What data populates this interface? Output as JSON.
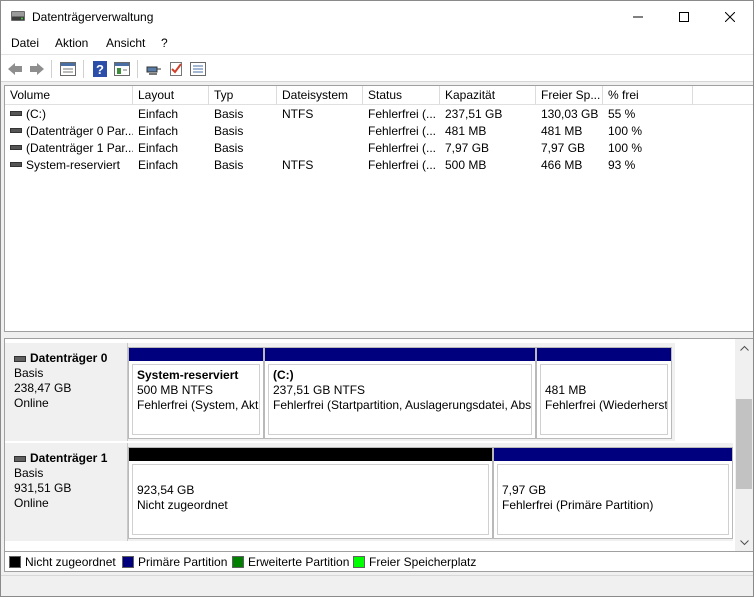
{
  "window": {
    "title": "Datenträgerverwaltung"
  },
  "menu": [
    "Datei",
    "Aktion",
    "Ansicht",
    "?"
  ],
  "toolbar": [
    "back-icon",
    "forward-icon",
    "properties-icon",
    "help-icon",
    "view-icon",
    "connect-icon",
    "check-icon",
    "list-icon"
  ],
  "volumes": {
    "columns": [
      "Volume",
      "Layout",
      "Typ",
      "Dateisystem",
      "Status",
      "Kapazität",
      "Freier Sp...",
      "% frei"
    ],
    "rows": [
      [
        "(C:)",
        "Einfach",
        "Basis",
        "NTFS",
        "Fehlerfrei (...",
        "237,51 GB",
        "130,03 GB",
        "55 %"
      ],
      [
        "(Datenträger 0 Par...",
        "Einfach",
        "Basis",
        "",
        "Fehlerfrei (...",
        "481 MB",
        "481 MB",
        "100 %"
      ],
      [
        "(Datenträger 1 Par...",
        "Einfach",
        "Basis",
        "",
        "Fehlerfrei (...",
        "7,97 GB",
        "7,97 GB",
        "100 %"
      ],
      [
        "System-reserviert",
        "Einfach",
        "Basis",
        "NTFS",
        "Fehlerfrei (...",
        "500 MB",
        "466 MB",
        "93 %"
      ]
    ]
  },
  "disks": [
    {
      "name": "Datenträger 0",
      "type": "Basis",
      "size": "238,47 GB",
      "state": "Online",
      "partitions": [
        {
          "name": "System-reserviert",
          "size": "500 MB NTFS",
          "status": "Fehlerfrei (System, Aktiv, Primäre Partition)",
          "bar_color": "#00007f"
        },
        {
          "name": "(C:)",
          "size": "237,51 GB NTFS",
          "status": "Fehlerfrei (Startpartition, Auslagerungsdatei, Absturzabbild, Primäre Partition)",
          "bar_color": "#00007f"
        },
        {
          "name": "",
          "size": "481 MB",
          "status": "Fehlerfrei (Wiederherstellungspartition)",
          "bar_color": "#00007f"
        }
      ]
    },
    {
      "name": "Datenträger 1",
      "type": "Basis",
      "size": "931,51 GB",
      "state": "Online",
      "partitions": [
        {
          "name": "",
          "size": "923,54 GB",
          "status": "Nicht zugeordnet",
          "bar_color": "#000000"
        },
        {
          "name": "",
          "size": "7,97 GB",
          "status": "Fehlerfrei (Primäre Partition)",
          "bar_color": "#00007f"
        }
      ]
    }
  ],
  "legend": [
    {
      "label": "Nicht zugeordnet",
      "color": "#000000"
    },
    {
      "label": "Primäre Partition",
      "color": "#00007f"
    },
    {
      "label": "Erweiterte Partition",
      "color": "#007f00"
    },
    {
      "label": "Freier Speicherplatz",
      "color": "#00ff00"
    }
  ]
}
